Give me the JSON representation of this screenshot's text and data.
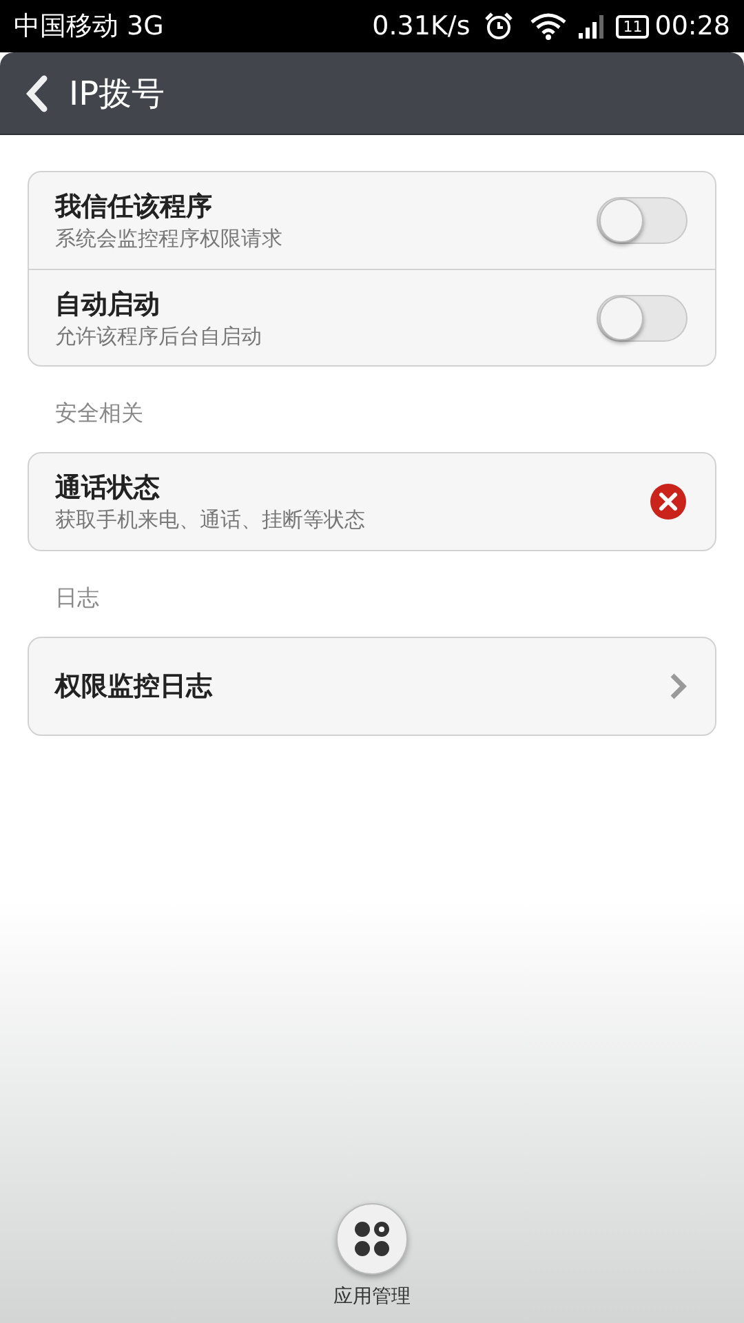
{
  "status_bar": {
    "carrier": "中国移动 3G",
    "speed": "0.31K/s",
    "battery": "11",
    "time": "00:28"
  },
  "title_bar": {
    "title": "IP拨号"
  },
  "sections": [
    {
      "items": [
        {
          "kind": "toggle",
          "title": "我信任该程序",
          "subtitle": "系统会监控程序权限请求",
          "on": false
        },
        {
          "kind": "toggle",
          "title": "自动启动",
          "subtitle": "允许该程序后台自启动",
          "on": false
        }
      ]
    },
    {
      "header": "安全相关",
      "items": [
        {
          "kind": "permission",
          "title": "通话状态",
          "subtitle": "获取手机来电、通话、挂断等状态",
          "allowed": false
        }
      ]
    },
    {
      "header": "日志",
      "items": [
        {
          "kind": "link",
          "title": "权限监控日志"
        }
      ]
    }
  ],
  "bottom_action": {
    "label": "应用管理"
  }
}
